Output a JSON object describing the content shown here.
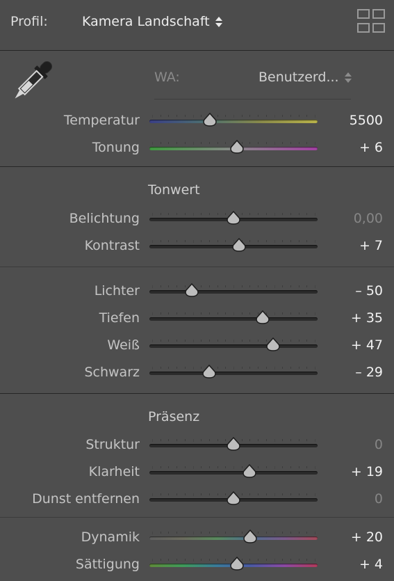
{
  "header": {
    "profile_label": "Profil:",
    "profile_value": "Kamera Landschaft",
    "grid_icon": "grid-view-icon"
  },
  "white_balance": {
    "label": "WA:",
    "value": "Benutzerd...",
    "eyedropper_icon": "eyedropper-icon"
  },
  "sliders_basic": [
    {
      "id": "temperatur",
      "label": "Temperatur",
      "value_text": "5500",
      "position": 0.36,
      "dim": false,
      "style": "temp"
    },
    {
      "id": "tonung",
      "label": "Tonung",
      "value_text": "+ 6",
      "position": 0.52,
      "dim": false,
      "style": "tint"
    }
  ],
  "tonwert": {
    "title": "Tonwert",
    "sliders": [
      {
        "id": "belichtung",
        "label": "Belichtung",
        "value_text": "0,00",
        "position": 0.5,
        "dim": true,
        "style": "plain"
      },
      {
        "id": "kontrast",
        "label": "Kontrast",
        "value_text": "+ 7",
        "position": 0.535,
        "dim": false,
        "style": "plain"
      }
    ]
  },
  "tonwert2": {
    "sliders": [
      {
        "id": "lichter",
        "label": "Lichter",
        "value_text": "– 50",
        "position": 0.25,
        "dim": false,
        "style": "plain"
      },
      {
        "id": "tiefen",
        "label": "Tiefen",
        "value_text": "+ 35",
        "position": 0.675,
        "dim": false,
        "style": "plain"
      },
      {
        "id": "weiss",
        "label": "Weiß",
        "value_text": "+ 47",
        "position": 0.735,
        "dim": false,
        "style": "plain"
      },
      {
        "id": "schwarz",
        "label": "Schwarz",
        "value_text": "– 29",
        "position": 0.355,
        "dim": false,
        "style": "plain"
      }
    ]
  },
  "praesenz": {
    "title": "Präsenz",
    "sliders": [
      {
        "id": "struktur",
        "label": "Struktur",
        "value_text": "0",
        "position": 0.5,
        "dim": true,
        "style": "plain"
      },
      {
        "id": "klarheit",
        "label": "Klarheit",
        "value_text": "+ 19",
        "position": 0.595,
        "dim": false,
        "style": "plain"
      },
      {
        "id": "dunst",
        "label": "Dunst entfernen",
        "value_text": "0",
        "position": 0.5,
        "dim": true,
        "style": "plain"
      }
    ]
  },
  "praesenz2": {
    "sliders": [
      {
        "id": "dynamik",
        "label": "Dynamik",
        "value_text": "+ 20",
        "position": 0.6,
        "dim": false,
        "style": "dyn"
      },
      {
        "id": "saettigung",
        "label": "Sättigung",
        "value_text": "+ 4",
        "position": 0.52,
        "dim": false,
        "style": "sat"
      }
    ]
  }
}
